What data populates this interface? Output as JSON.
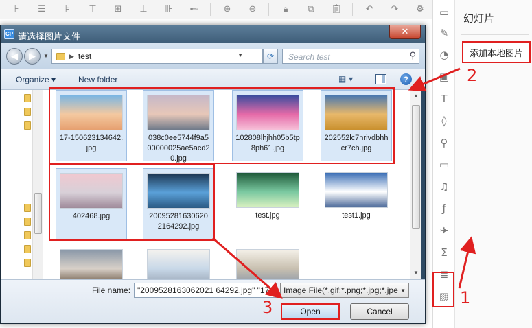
{
  "toolbar": {
    "icons": [
      "align-left-icon",
      "align-center-h-icon",
      "align-right-icon",
      "align-top-icon",
      "align-middle-icon",
      "align-bottom-icon",
      "distribute-h-icon",
      "distribute-v-icon",
      "zoom-in-icon",
      "zoom-out-icon",
      "lock-icon",
      "copy-icon",
      "paste-icon",
      "undo-icon",
      "redo-icon",
      "settings-icon"
    ]
  },
  "right_panel": {
    "title": "幻灯片",
    "add_local_image": "添加本地图片"
  },
  "dialog": {
    "title": "请选择图片文件",
    "path": "test",
    "search_placeholder": "Search test",
    "organize": "Organize ▾",
    "new_folder": "New folder",
    "help": "?",
    "files": [
      {
        "name": "17-150623134642.jpg",
        "selected": true,
        "colors": [
          "#7ab6e3",
          "#f4c9a0",
          "#e6a070"
        ]
      },
      {
        "name": "038c0ee5744f9a500000025ae5acd20.jpg",
        "selected": true,
        "colors": [
          "#c6b8c8",
          "#e7c7b8",
          "#6f7a8a"
        ]
      },
      {
        "name": "102808lhjhh05b5tp8ph61.jpg",
        "selected": true,
        "colors": [
          "#3a4c9e",
          "#e56aa8",
          "#f6c0d8"
        ]
      },
      {
        "name": "202552lc7nrivdbhhcr7ch.jpg",
        "selected": true,
        "colors": [
          "#4a78b0",
          "#e8b86a",
          "#c9902e"
        ]
      },
      {
        "name": "402468.jpg",
        "selected": true,
        "colors": [
          "#f0c8d0",
          "#d8d0d8",
          "#9f8a9a"
        ]
      },
      {
        "name": "20095281630620 2164292.jpg",
        "selected": true,
        "colors": [
          "#1c3550",
          "#5aa0d8",
          "#2b5a84"
        ]
      },
      {
        "name": "test.jpg",
        "selected": false,
        "colors": [
          "#1f5a3a",
          "#7ac8a0",
          "#d8f0c0"
        ]
      },
      {
        "name": "test1.jpg",
        "selected": false,
        "colors": [
          "#3c6fb6",
          "#ffffff",
          "#4c6a9a"
        ]
      },
      {
        "name": "",
        "selected": false,
        "colors": [
          "#8a98a8",
          "#d8d0c8",
          "#6c5a48"
        ]
      },
      {
        "name": "",
        "selected": false,
        "colors": [
          "#f4f2ee",
          "#c8d8e8",
          "#9aa8b8"
        ]
      },
      {
        "name": "",
        "selected": false,
        "colors": [
          "#f4f0e8",
          "#c8c0b0",
          "#8c98a8"
        ]
      }
    ],
    "file_name_label": "File name:",
    "file_name_value": "\"2009528163062021 64292.jpg\" \"17-",
    "filter_value": "Image File(*.gif;*.png;*.jpg;*.jpe",
    "open": "Open",
    "cancel": "Cancel"
  },
  "annotations": {
    "step1": "1",
    "step2": "2",
    "step3": "3"
  }
}
